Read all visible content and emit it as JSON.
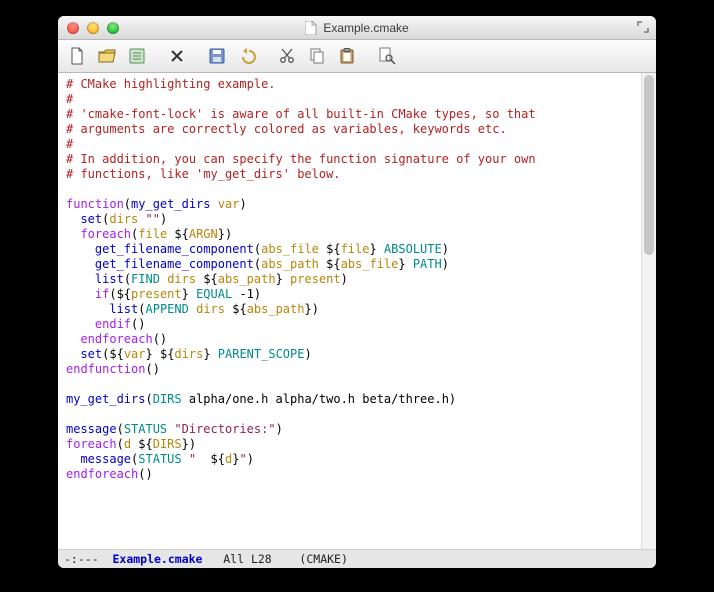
{
  "window": {
    "title": "Example.cmake"
  },
  "toolbar": {
    "items": [
      {
        "name": "new-file-icon"
      },
      {
        "name": "open-file-icon"
      },
      {
        "name": "dired-icon"
      },
      {
        "name": "close-icon"
      },
      {
        "name": "save-icon"
      },
      {
        "name": "undo-icon"
      },
      {
        "name": "cut-icon"
      },
      {
        "name": "copy-icon"
      },
      {
        "name": "paste-icon"
      },
      {
        "name": "search-icon"
      }
    ]
  },
  "code": {
    "lines": [
      [
        {
          "c": "cmt",
          "t": "# CMake highlighting example."
        }
      ],
      [
        {
          "c": "cmt",
          "t": "#"
        }
      ],
      [
        {
          "c": "cmt",
          "t": "# 'cmake-font-lock' is aware of all built-in CMake types, so that"
        }
      ],
      [
        {
          "c": "cmt",
          "t": "# arguments are correctly colored as variables, keywords etc."
        }
      ],
      [
        {
          "c": "cmt",
          "t": "#"
        }
      ],
      [
        {
          "c": "cmt",
          "t": "# In addition, you can specify the function signature of your own"
        }
      ],
      [
        {
          "c": "cmt",
          "t": "# functions, like 'my_get_dirs' below."
        }
      ],
      [],
      [
        {
          "c": "kw",
          "t": "function"
        },
        {
          "c": "p",
          "t": "("
        },
        {
          "c": "fn",
          "t": "my_get_dirs"
        },
        {
          "c": "p",
          "t": " "
        },
        {
          "c": "vr",
          "t": "var"
        },
        {
          "c": "p",
          "t": ")"
        }
      ],
      [
        {
          "c": "p",
          "t": "  "
        },
        {
          "c": "fn",
          "t": "set"
        },
        {
          "c": "p",
          "t": "("
        },
        {
          "c": "vr",
          "t": "dirs"
        },
        {
          "c": "p",
          "t": " "
        },
        {
          "c": "st",
          "t": "\"\""
        },
        {
          "c": "p",
          "t": ")"
        }
      ],
      [
        {
          "c": "p",
          "t": "  "
        },
        {
          "c": "kw",
          "t": "foreach"
        },
        {
          "c": "p",
          "t": "("
        },
        {
          "c": "vr",
          "t": "file"
        },
        {
          "c": "p",
          "t": " ${"
        },
        {
          "c": "vr",
          "t": "ARGN"
        },
        {
          "c": "p",
          "t": "})"
        }
      ],
      [
        {
          "c": "p",
          "t": "    "
        },
        {
          "c": "fn",
          "t": "get_filename_component"
        },
        {
          "c": "p",
          "t": "("
        },
        {
          "c": "vr",
          "t": "abs_file"
        },
        {
          "c": "p",
          "t": " ${"
        },
        {
          "c": "vr",
          "t": "file"
        },
        {
          "c": "p",
          "t": "} "
        },
        {
          "c": "cn",
          "t": "ABSOLUTE"
        },
        {
          "c": "p",
          "t": ")"
        }
      ],
      [
        {
          "c": "p",
          "t": "    "
        },
        {
          "c": "fn",
          "t": "get_filename_component"
        },
        {
          "c": "p",
          "t": "("
        },
        {
          "c": "vr",
          "t": "abs_path"
        },
        {
          "c": "p",
          "t": " ${"
        },
        {
          "c": "vr",
          "t": "abs_file"
        },
        {
          "c": "p",
          "t": "} "
        },
        {
          "c": "cn",
          "t": "PATH"
        },
        {
          "c": "p",
          "t": ")"
        }
      ],
      [
        {
          "c": "p",
          "t": "    "
        },
        {
          "c": "fn",
          "t": "list"
        },
        {
          "c": "p",
          "t": "("
        },
        {
          "c": "cn",
          "t": "FIND"
        },
        {
          "c": "p",
          "t": " "
        },
        {
          "c": "vr",
          "t": "dirs"
        },
        {
          "c": "p",
          "t": " ${"
        },
        {
          "c": "vr",
          "t": "abs_path"
        },
        {
          "c": "p",
          "t": "} "
        },
        {
          "c": "vr",
          "t": "present"
        },
        {
          "c": "p",
          "t": ")"
        }
      ],
      [
        {
          "c": "p",
          "t": "    "
        },
        {
          "c": "kw",
          "t": "if"
        },
        {
          "c": "p",
          "t": "(${"
        },
        {
          "c": "vr",
          "t": "present"
        },
        {
          "c": "p",
          "t": "} "
        },
        {
          "c": "cn",
          "t": "EQUAL"
        },
        {
          "c": "p",
          "t": " "
        },
        {
          "c": "nm",
          "t": "-1"
        },
        {
          "c": "p",
          "t": ")"
        }
      ],
      [
        {
          "c": "p",
          "t": "      "
        },
        {
          "c": "fn",
          "t": "list"
        },
        {
          "c": "p",
          "t": "("
        },
        {
          "c": "cn",
          "t": "APPEND"
        },
        {
          "c": "p",
          "t": " "
        },
        {
          "c": "vr",
          "t": "dirs"
        },
        {
          "c": "p",
          "t": " ${"
        },
        {
          "c": "vr",
          "t": "abs_path"
        },
        {
          "c": "p",
          "t": "})"
        }
      ],
      [
        {
          "c": "p",
          "t": "    "
        },
        {
          "c": "kw",
          "t": "endif"
        },
        {
          "c": "p",
          "t": "()"
        }
      ],
      [
        {
          "c": "p",
          "t": "  "
        },
        {
          "c": "kw",
          "t": "endforeach"
        },
        {
          "c": "p",
          "t": "()"
        }
      ],
      [
        {
          "c": "p",
          "t": "  "
        },
        {
          "c": "fn",
          "t": "set"
        },
        {
          "c": "p",
          "t": "(${"
        },
        {
          "c": "vr",
          "t": "var"
        },
        {
          "c": "p",
          "t": "} ${"
        },
        {
          "c": "vr",
          "t": "dirs"
        },
        {
          "c": "p",
          "t": "} "
        },
        {
          "c": "cn",
          "t": "PARENT_SCOPE"
        },
        {
          "c": "p",
          "t": ")"
        }
      ],
      [
        {
          "c": "kw",
          "t": "endfunction"
        },
        {
          "c": "p",
          "t": "()"
        }
      ],
      [],
      [
        {
          "c": "fn",
          "t": "my_get_dirs"
        },
        {
          "c": "p",
          "t": "("
        },
        {
          "c": "cn",
          "t": "DIRS"
        },
        {
          "c": "p",
          "t": " alpha/one.h alpha/two.h beta/three.h)"
        }
      ],
      [],
      [
        {
          "c": "fn",
          "t": "message"
        },
        {
          "c": "p",
          "t": "("
        },
        {
          "c": "cn",
          "t": "STATUS"
        },
        {
          "c": "p",
          "t": " "
        },
        {
          "c": "st",
          "t": "\"Directories:\""
        },
        {
          "c": "p",
          "t": ")"
        }
      ],
      [
        {
          "c": "kw",
          "t": "foreach"
        },
        {
          "c": "p",
          "t": "("
        },
        {
          "c": "vr",
          "t": "d"
        },
        {
          "c": "p",
          "t": " ${"
        },
        {
          "c": "vr",
          "t": "DIRS"
        },
        {
          "c": "p",
          "t": "})"
        }
      ],
      [
        {
          "c": "p",
          "t": "  "
        },
        {
          "c": "fn",
          "t": "message"
        },
        {
          "c": "p",
          "t": "("
        },
        {
          "c": "cn",
          "t": "STATUS"
        },
        {
          "c": "p",
          "t": " "
        },
        {
          "c": "st",
          "t": "\"  "
        },
        {
          "c": "p",
          "t": "${"
        },
        {
          "c": "vr",
          "t": "d"
        },
        {
          "c": "p",
          "t": "}"
        },
        {
          "c": "st",
          "t": "\""
        },
        {
          "c": "p",
          "t": ")"
        }
      ],
      [
        {
          "c": "kw",
          "t": "endforeach"
        },
        {
          "c": "p",
          "t": "()"
        }
      ]
    ]
  },
  "statusbar": {
    "modeline_left": "-:---  ",
    "filename": "Example.cmake",
    "position": "   All L28    ",
    "mode": "(CMAKE)"
  }
}
